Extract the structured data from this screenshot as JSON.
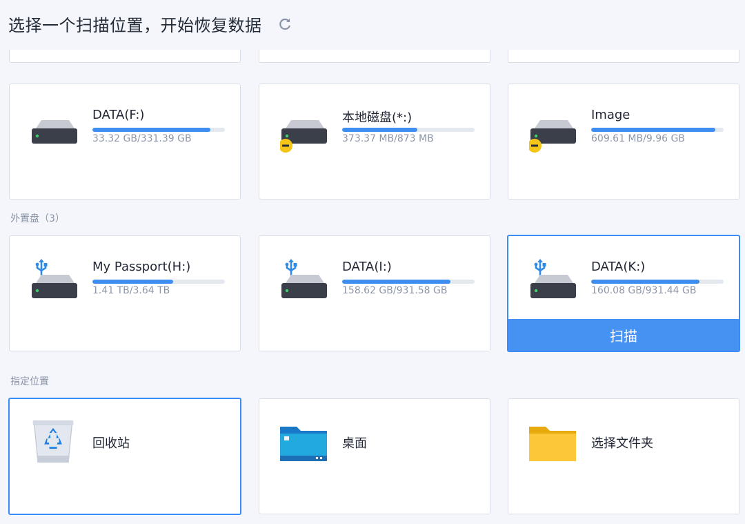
{
  "header": {
    "title": "选择一个扫描位置，开始恢复数据"
  },
  "local_drives": [
    {
      "name": "DATA(F:)",
      "size": "33.32 GB/331.39 GB",
      "usage": 0.89,
      "warning": false
    },
    {
      "name": "本地磁盘(*:)",
      "size": "373.37 MB/873 MB",
      "usage": 0.57,
      "warning": true
    },
    {
      "name": "Image",
      "size": "609.61 MB/9.96 GB",
      "usage": 0.94,
      "warning": true
    }
  ],
  "external": {
    "label": "外置盘（3）",
    "drives": [
      {
        "name": "My Passport(H:)",
        "size": "1.41 TB/3.64 TB",
        "usage": 0.61
      },
      {
        "name": "DATA(I:)",
        "size": "158.62 GB/931.58 GB",
        "usage": 0.82
      },
      {
        "name": "DATA(K:)",
        "size": "160.08 GB/931.44 GB",
        "usage": 0.82,
        "selected": true
      }
    ],
    "scan_label": "扫描"
  },
  "locations": {
    "label": "指定位置",
    "items": [
      {
        "name": "回收站",
        "icon": "recycle-bin-icon"
      },
      {
        "name": "桌面",
        "icon": "desktop-folder-icon"
      },
      {
        "name": "选择文件夹",
        "icon": "folder-icon"
      }
    ]
  },
  "colors": {
    "accent": "#4592f3",
    "bar_fill": "#3d8ef0",
    "warning": "#f5c518",
    "usb": "#2f8ae6"
  }
}
